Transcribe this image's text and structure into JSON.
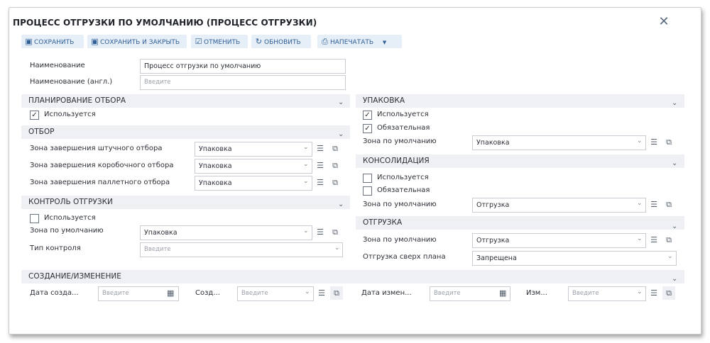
{
  "dialog": {
    "title": "ПРОЦЕСС ОТГРУЗКИ ПО УМОЛЧАНИЮ (ПРОЦЕСС ОТГРУЗКИ)"
  },
  "toolbar": {
    "save": "СОХРАНИТЬ",
    "save_close": "СОХРАНИТЬ И ЗАКРЫТЬ",
    "cancel": "ОТМЕНИТЬ",
    "refresh": "ОБНОВИТЬ",
    "print": "НАПЕЧАТАТЬ"
  },
  "general": {
    "name_label": "Наименование",
    "name_value": "Процесс отгрузки по умолчанию",
    "name_en_label": "Наименование (англ.)",
    "name_en_placeholder": "Введите"
  },
  "picking_planning": {
    "title": "ПЛАНИРОВАНИЕ ОТБОРА",
    "used_label": "Используется",
    "used_checked": true
  },
  "picking": {
    "title": "ОТБОР",
    "rows": [
      {
        "label": "Зона завершения штучного отбора",
        "value": "Упаковка"
      },
      {
        "label": "Зона завершения коробочного отбора",
        "value": "Упаковка"
      },
      {
        "label": "Зона завершения паллетного отбора",
        "value": "Упаковка"
      }
    ]
  },
  "shipping_control": {
    "title": "КОНТРОЛЬ ОТГРУЗКИ",
    "used_label": "Используется",
    "used_checked": false,
    "zone_label": "Зона по умолчанию",
    "zone_value": "Упаковка",
    "type_label": "Тип контроля",
    "type_placeholder": "Введите"
  },
  "packing": {
    "title": "УПАКОВКА",
    "used_label": "Используется",
    "used_checked": true,
    "required_label": "Обязательная",
    "required_checked": true,
    "zone_label": "Зона по умолчанию",
    "zone_value": "Упаковка"
  },
  "consolidation": {
    "title": "КОНСОЛИДАЦИЯ",
    "used_label": "Используется",
    "used_checked": false,
    "required_label": "Обязательная",
    "required_checked": false,
    "zone_label": "Зона по умолчанию",
    "zone_value": "Отгрузка"
  },
  "shipment": {
    "title": "ОТГРУЗКА",
    "zone_label": "Зона по умолчанию",
    "zone_value": "Отгрузка",
    "over_plan_label": "Отгрузка сверх плана",
    "over_plan_value": "Запрещена"
  },
  "audit": {
    "title": "СОЗДАНИЕ/ИЗМЕНЕНИЕ",
    "created_date_label": "Дата созда...",
    "created_by_label": "Созд...",
    "modified_date_label": "Дата измен...",
    "modified_by_label": "Изм...",
    "placeholder": "Введите"
  },
  "icons": {
    "check": "✓",
    "chevron": "⌄",
    "close": "✕"
  }
}
